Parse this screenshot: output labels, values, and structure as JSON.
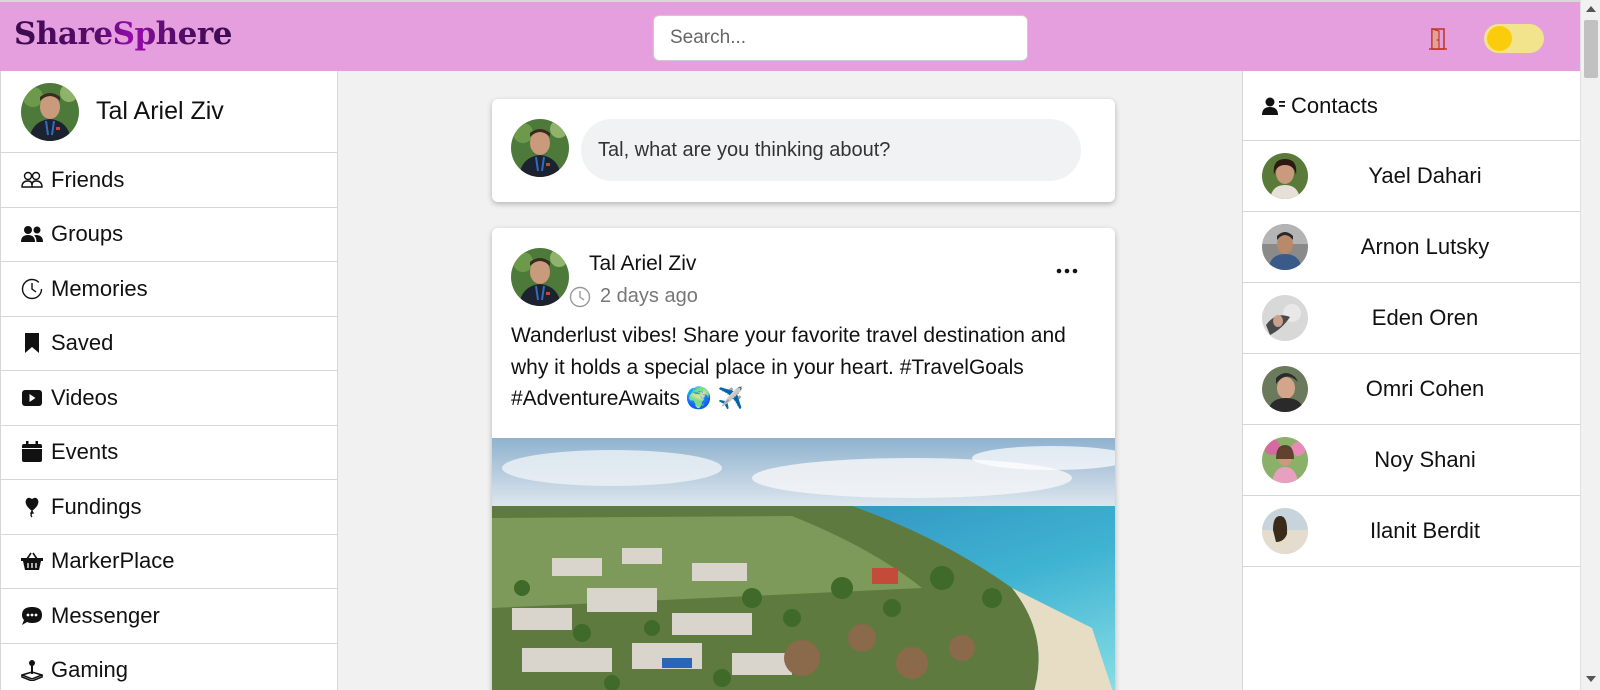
{
  "header": {
    "logo": "ShareSphere",
    "search_placeholder": "Search...",
    "logout_icon": "door-icon",
    "theme_toggle": {
      "state": "light",
      "knob_color": "#fbcc0c",
      "track_color": "#f1e48c"
    },
    "background": "#e69fde"
  },
  "user": {
    "name": "Tal Ariel Ziv"
  },
  "sidebar": {
    "items": [
      {
        "label": "Friends",
        "icon": "friends-icon"
      },
      {
        "label": "Groups",
        "icon": "groups-icon"
      },
      {
        "label": "Memories",
        "icon": "clock-icon"
      },
      {
        "label": "Saved",
        "icon": "bookmark-icon"
      },
      {
        "label": "Videos",
        "icon": "video-icon"
      },
      {
        "label": "Events",
        "icon": "calendar-icon"
      },
      {
        "label": "Fundings",
        "icon": "balloon-icon"
      },
      {
        "label": "MarkerPlace",
        "icon": "basket-icon"
      },
      {
        "label": "Messenger",
        "icon": "chat-icon"
      },
      {
        "label": "Gaming",
        "icon": "joystick-icon"
      }
    ]
  },
  "composer": {
    "placeholder": "Tal, what are you thinking about?"
  },
  "post": {
    "author": "Tal Ariel Ziv",
    "time": "2 days ago",
    "text": "Wanderlust vibes! Share your favorite travel destination and why it holds a special place in your heart. #TravelGoals #AdventureAwaits 🌍 ✈️",
    "image": "aerial-beach-resort-photo"
  },
  "contacts": {
    "title": "Contacts",
    "items": [
      {
        "name": "Yael Dahari"
      },
      {
        "name": "Arnon Lutsky"
      },
      {
        "name": "Eden Oren"
      },
      {
        "name": "Omri Cohen"
      },
      {
        "name": "Noy Shani"
      },
      {
        "name": "Ilanit Berdit"
      }
    ]
  }
}
